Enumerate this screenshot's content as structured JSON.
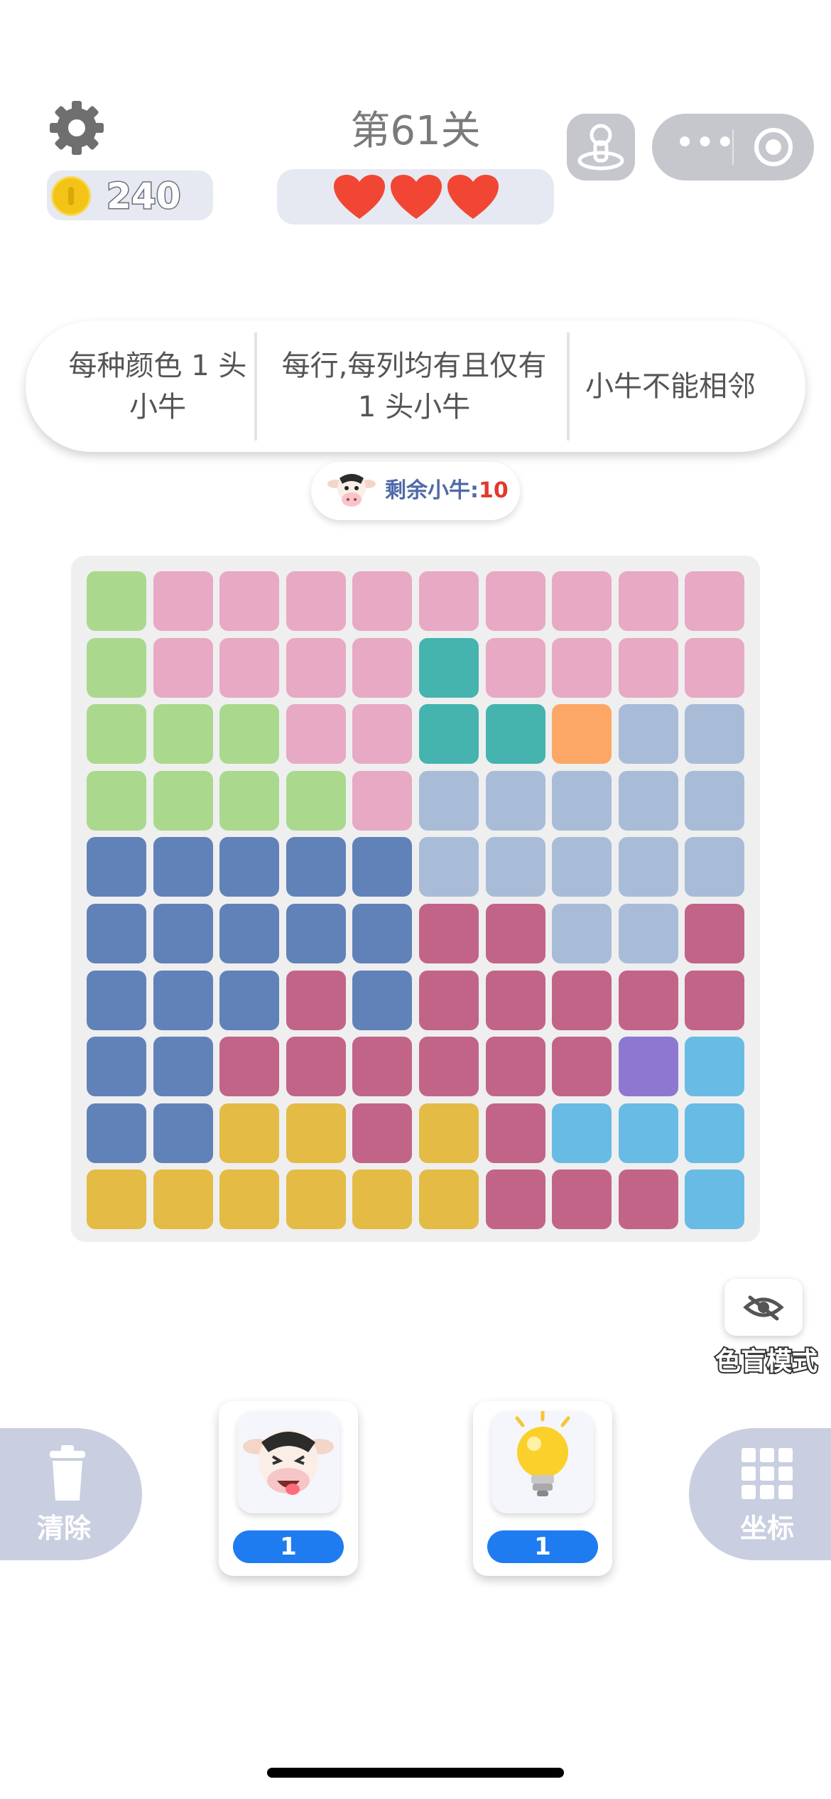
{
  "header": {
    "coins": "240",
    "level_title": "第61关",
    "lives": 3
  },
  "rules": [
    {
      "text": "每种颜色 1 头小牛"
    },
    {
      "text": "每行,每列均有且仅有 1 头小牛"
    },
    {
      "text": "小牛不能相邻"
    }
  ],
  "remaining": {
    "label": "剩余小牛:",
    "value": "10"
  },
  "board": {
    "rows": 10,
    "cols": 10,
    "palette": {
      "G": "#aad98e",
      "P": "#e7a9c3",
      "T": "#45b3ae",
      "O": "#fda766",
      "L": "#a8bcd8",
      "B": "#6182b8",
      "M": "#c26488",
      "V": "#8e77d1",
      "S": "#68bbe4",
      "Y": "#e3bb45"
    },
    "grid": [
      "GPPPPPPPPP",
      "GPPPPTPPPP",
      "GGGPPTTOLL",
      "GGGGPLLLLL",
      "BBBBBLLLLL",
      "BBBBBMMLLM",
      "BBBMBMMMMM",
      "BBMMMMMMVS",
      "BBYYMYMSSS",
      "YYYYYYMMMS"
    ]
  },
  "colorblind": {
    "label": "色盲模式",
    "icon": "eye-slash-icon"
  },
  "tools": {
    "clear_label": "清除",
    "coords_label": "坐标",
    "cow_count": "1",
    "hint_count": "1"
  }
}
